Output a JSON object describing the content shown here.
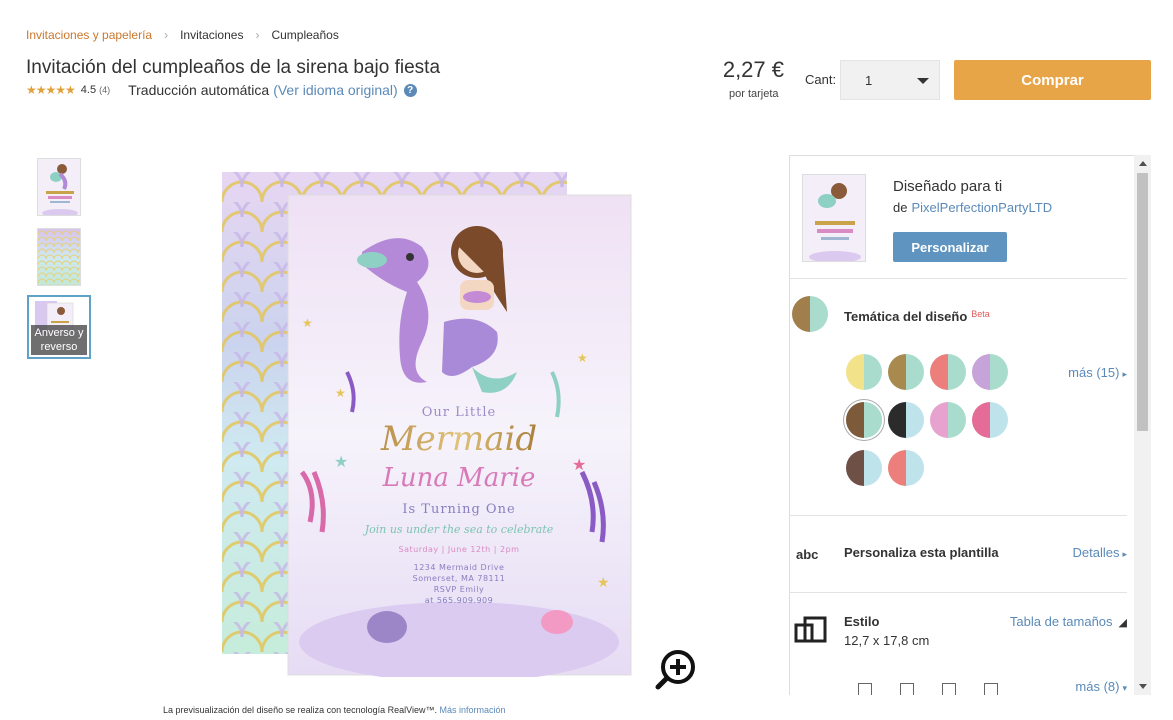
{
  "breadcrumb": [
    "Invitaciones y papelería",
    "Invitaciones",
    "Cumpleaños"
  ],
  "product": {
    "title": "Invitación del cumpleaños de la sirena bajo fiesta",
    "rating": "4.5",
    "rating_count": "(4)",
    "auto_translation": "Traducción automática",
    "original_link": "(Ver idioma original)",
    "price": "2,27 €",
    "price_unit": "por tarjeta"
  },
  "purchase": {
    "qty_label": "Cant:",
    "qty_value": "1",
    "buy_label": "Comprar"
  },
  "thumbnails": {
    "back_label_1": "Anverso y",
    "back_label_2": "reverso"
  },
  "preview": {
    "card_line1": "Our Little",
    "card_line2": "Mermaid",
    "card_name": "Luna Marie",
    "card_age": "Is Turning One",
    "card_invite": "Join us under the sea to celebrate",
    "card_date": "Saturday | June 12th | 2pm",
    "card_addr1": "1234 Mermaid Drive",
    "card_addr2": "Somerset, MA 78111",
    "card_rsvp": "RSVP Emily",
    "card_phone": "at 565.909.909",
    "realview_text": "La previsualización del diseño se realiza con tecnología RealView™.",
    "realview_link": "Más información"
  },
  "panel": {
    "designed_title": "Diseñado para ti",
    "designed_by": "de",
    "author": "PixelPerfectionPartyLTD",
    "personalize": "Personalizar",
    "theme_title": "Temática del diseño",
    "beta": "Beta",
    "more_themes": "más (15)",
    "abc": "abc",
    "custom_title": "Personaliza esta plantilla",
    "details": "Detalles",
    "style_title": "Estilo",
    "style_size": "12,7 x 17,8 cm",
    "size_chart": "Tabla de tamaños",
    "more_sizes": "más (8)"
  },
  "colors": {
    "accent_orange": "#e8a548",
    "link_blue": "#5b8ab8",
    "button_blue": "#5e94bf",
    "breadcrumb_orange": "#c9782e"
  },
  "swatches": [
    [
      "#f2e28a",
      "#a9dccd"
    ],
    [
      "#a98a4e",
      "#a9dccd"
    ],
    [
      "#ec7f7b",
      "#a9dccd"
    ],
    [
      "#c6a3d8",
      "#a9dccd"
    ],
    [
      "#7c5a3a",
      "#a9dccd"
    ],
    [
      "#2b2b2b",
      "#bfe3ea"
    ],
    [
      "#e8a2d0",
      "#a9dccd"
    ],
    [
      "#e56c97",
      "#bfe3ea"
    ],
    [
      "#6e5046",
      "#bfe3ea"
    ],
    [
      "#ec7f7b",
      "#bfe3ea"
    ]
  ]
}
